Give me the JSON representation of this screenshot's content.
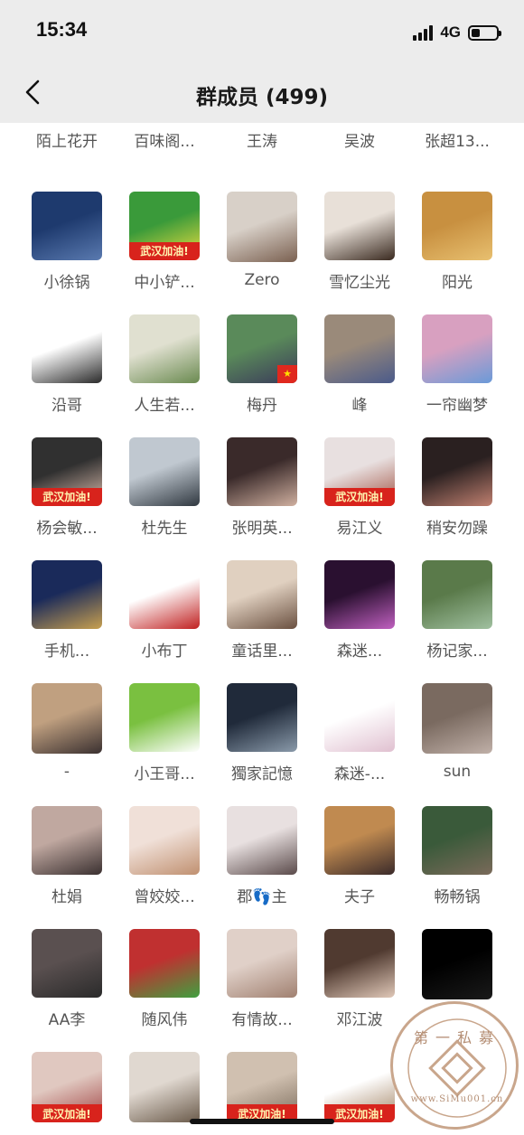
{
  "status_bar": {
    "time": "15:34",
    "network": "4G"
  },
  "header": {
    "title": "群成员 (499)",
    "back_icon": "chevron-left-icon"
  },
  "badge_text": "武汉加油!",
  "members": [
    {
      "name": "陌上花开",
      "colors": [
        "#f2f2f2",
        "#b52a2a"
      ]
    },
    {
      "name": "百味阁...",
      "colors": [
        "#4a3b3b",
        "#9a2c22"
      ]
    },
    {
      "name": "王涛",
      "colors": [
        "#9a9aa0",
        "#3c3c44"
      ]
    },
    {
      "name": "吴波",
      "colors": [
        "#3a3a3a",
        "#8c8c8c"
      ]
    },
    {
      "name": "张超13...",
      "colors": [
        "#e8d8c8",
        "#c07050"
      ]
    },
    {
      "name": "小徐锅",
      "colors": [
        "#1e3a6e",
        "#5a7ab0"
      ]
    },
    {
      "name": "中小铲...",
      "colors": [
        "#3a9a3a",
        "#f0e040"
      ],
      "badge": true
    },
    {
      "name": "Zero",
      "colors": [
        "#d8d0c8",
        "#7a6050"
      ]
    },
    {
      "name": "雪忆尘光",
      "colors": [
        "#e8e0d8",
        "#3a2a20"
      ]
    },
    {
      "name": "阳光",
      "colors": [
        "#c89040",
        "#e8c070"
      ]
    },
    {
      "name": "沿哥",
      "colors": [
        "#ffffff",
        "#2a2a2a"
      ]
    },
    {
      "name": "人生若...",
      "colors": [
        "#e0e0d0",
        "#6a8a50"
      ]
    },
    {
      "name": "梅丹",
      "colors": [
        "#5a8a5a",
        "#3a3a5a"
      ],
      "flag": true
    },
    {
      "name": "峰",
      "colors": [
        "#9a8a7a",
        "#4a5a8a"
      ]
    },
    {
      "name": "一帘幽梦",
      "colors": [
        "#d8a0c0",
        "#6a9ad8"
      ]
    },
    {
      "name": "杨会敏...",
      "colors": [
        "#303030",
        "#e0c0b0"
      ],
      "badge": true
    },
    {
      "name": "杜先生",
      "colors": [
        "#c0c8d0",
        "#303840"
      ]
    },
    {
      "name": "张明英...",
      "colors": [
        "#3a2a2a",
        "#d0b0a0"
      ]
    },
    {
      "name": "易江义",
      "colors": [
        "#e8e0e0",
        "#a05040"
      ],
      "badge": true
    },
    {
      "name": "稍安勿躁",
      "colors": [
        "#2a2020",
        "#c08070"
      ]
    },
    {
      "name": "手机...",
      "colors": [
        "#1a2a5a",
        "#c8a050"
      ]
    },
    {
      "name": "小布丁",
      "colors": [
        "#ffffff",
        "#c02020"
      ]
    },
    {
      "name": "童话里...",
      "colors": [
        "#e0d0c0",
        "#6a5040"
      ]
    },
    {
      "name": "森迷...",
      "colors": [
        "#2a1030",
        "#c060c0"
      ]
    },
    {
      "name": "杨记家...",
      "colors": [
        "#5a7a4a",
        "#a0c0a0"
      ]
    },
    {
      "name": "-",
      "colors": [
        "#c0a080",
        "#3a3030"
      ]
    },
    {
      "name": "小王哥...",
      "colors": [
        "#7ac040",
        "#ffffff"
      ]
    },
    {
      "name": "獨家記憶",
      "colors": [
        "#202a3a",
        "#8a9aaa"
      ]
    },
    {
      "name": "森迷-...",
      "colors": [
        "#ffffff",
        "#e0c0d0"
      ]
    },
    {
      "name": "sun",
      "colors": [
        "#7a6a60",
        "#c0b0a8"
      ]
    },
    {
      "name": "杜娟",
      "colors": [
        "#c0a8a0",
        "#3a3030"
      ]
    },
    {
      "name": "曾姣姣...",
      "colors": [
        "#f0e0d8",
        "#c09070"
      ]
    },
    {
      "name": "郡👣主",
      "colors": [
        "#e8e0e0",
        "#5a4a4a"
      ]
    },
    {
      "name": "夫子",
      "colors": [
        "#c08a50",
        "#3a2a2a"
      ]
    },
    {
      "name": "畅畅锅",
      "colors": [
        "#3a5a3a",
        "#7a6a5a"
      ]
    },
    {
      "name": "AA李",
      "colors": [
        "#5a5050",
        "#2a2a2a"
      ]
    },
    {
      "name": "随风伟",
      "colors": [
        "#c03030",
        "#40a040"
      ]
    },
    {
      "name": "有情故...",
      "colors": [
        "#e0d0c8",
        "#a08070"
      ]
    },
    {
      "name": "邓江波",
      "colors": [
        "#503a30",
        "#e0c8b8"
      ]
    },
    {
      "name": "",
      "colors": [
        "#000000",
        "#1a1a1a"
      ]
    },
    {
      "name": "",
      "colors": [
        "#e0c8c0",
        "#a04040"
      ],
      "badge": true
    },
    {
      "name": "",
      "colors": [
        "#e0d8d0",
        "#6a5a4a"
      ]
    },
    {
      "name": "",
      "colors": [
        "#d0c0b0",
        "#7a6a5a"
      ],
      "badge": true
    },
    {
      "name": "",
      "colors": [
        "#ffffff",
        "#a08060"
      ],
      "badge": true
    },
    {
      "name": "",
      "colors": [
        "#ffffff",
        "#ffffff"
      ]
    }
  ],
  "watermark": {
    "top_text": "第一私募",
    "bottom_text": "www.SiMu001.cn"
  }
}
